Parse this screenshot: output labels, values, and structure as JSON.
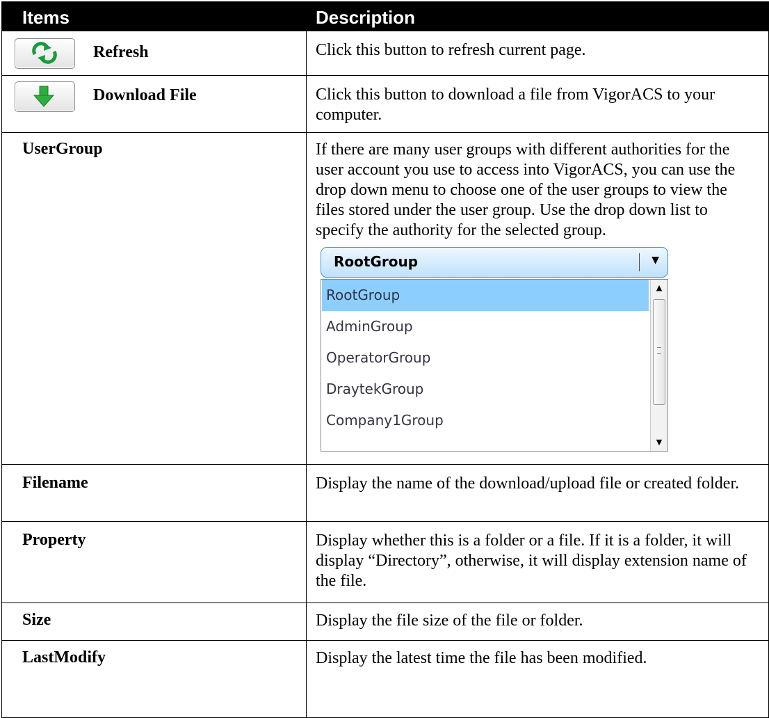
{
  "header": {
    "col1": "Items",
    "col2": "Description"
  },
  "rows": [
    {
      "label": "Refresh",
      "desc": "Click this button to refresh current page.",
      "icon": "refresh-icon"
    },
    {
      "label": "Download File",
      "desc": "Click this button to download a file from VigorACS to your computer.",
      "icon": "download-icon"
    },
    {
      "label": "UserGroup",
      "desc": "If there are many user groups with different authorities for the user account you use to access into VigorACS, you can use the drop down menu to choose one of the user groups to view the files stored under the user group. Use the drop down list to specify the authority for the selected group."
    },
    {
      "label": "Filename",
      "desc": "Display the name of the download/upload file or created folder."
    },
    {
      "label": "Property",
      "desc": "Display whether this is a folder or a file. If it is a folder, it will display “Directory”, otherwise, it will display extension name of the file."
    },
    {
      "label": "Size",
      "desc": "Display the file size of the file or folder."
    },
    {
      "label": "LastModify",
      "desc": "Display the latest time the file has been modified."
    }
  ],
  "dropdown": {
    "selected": "RootGroup",
    "options": [
      "RootGroup",
      "AdminGroup",
      "OperatorGroup",
      "DraytekGroup",
      "Company1Group"
    ]
  },
  "colors": {
    "header_bg": "#000000",
    "refresh_icon": "#1a9a3a",
    "download_icon": "#2eae3e",
    "selected_option": "#8ccfff"
  }
}
